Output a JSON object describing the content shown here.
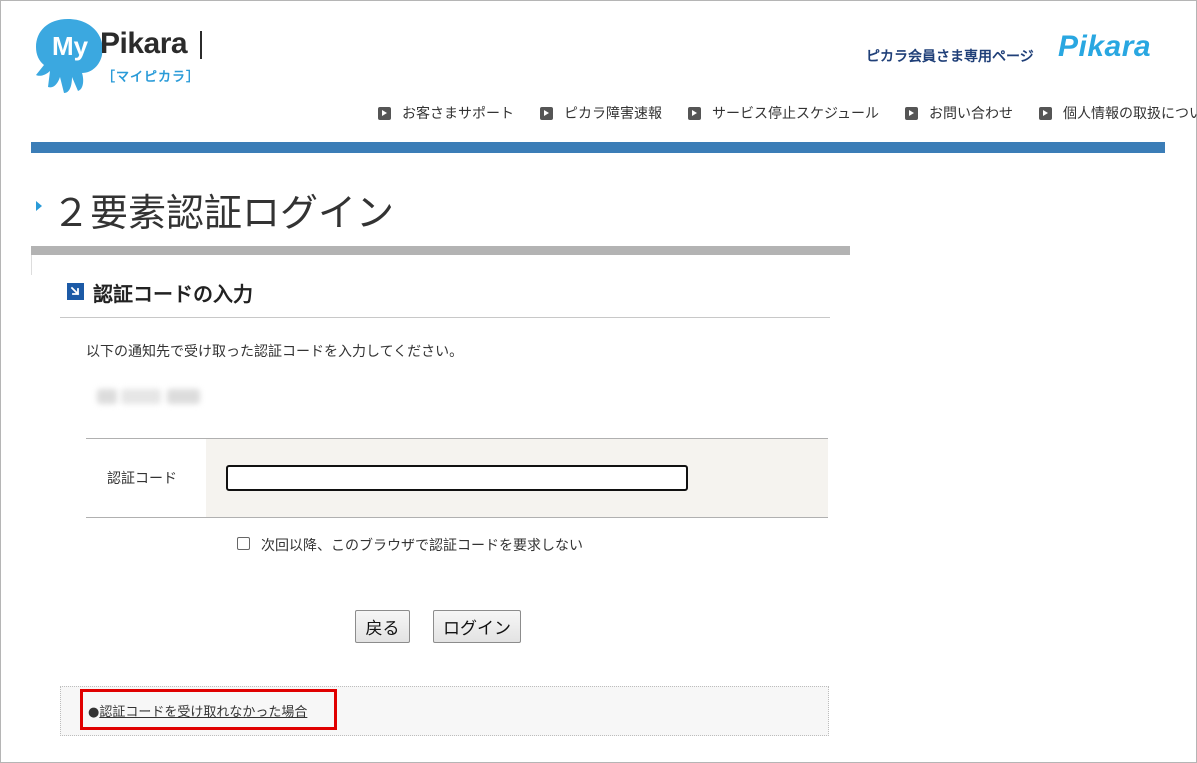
{
  "header": {
    "logo_my": "My",
    "logo_name": "Pikara",
    "logo_sub": "［マイピカラ］",
    "brand_label": "ピカラ会員さま専用ページ",
    "brand_logo": "Pikara"
  },
  "topnav": {
    "items": [
      {
        "label": "お客さまサポート"
      },
      {
        "label": "ピカラ障害速報"
      },
      {
        "label": "サービス停止スケジュール"
      },
      {
        "label": "お問い合わせ"
      },
      {
        "label": "個人情報の取扱について"
      }
    ]
  },
  "page": {
    "title": "２要素認証ログイン"
  },
  "section": {
    "title": "認証コードの入力",
    "instruction": "以下の通知先で受け取った認証コードを入力してください。"
  },
  "form": {
    "code_label": "認証コード",
    "code_value": "",
    "remember_label": "次回以降、このブラウザで認証コードを要求しない",
    "remember_checked": false
  },
  "buttons": {
    "back": "戻る",
    "login": "ログイン"
  },
  "help": {
    "bullet": "●",
    "link_text": "認証コードを受け取れなかった場合"
  },
  "colors": {
    "accent_blue": "#3b7db7",
    "logo_blue": "#29a7e1",
    "section_icon": "#1c5aa6",
    "highlight_red": "#e00000"
  }
}
